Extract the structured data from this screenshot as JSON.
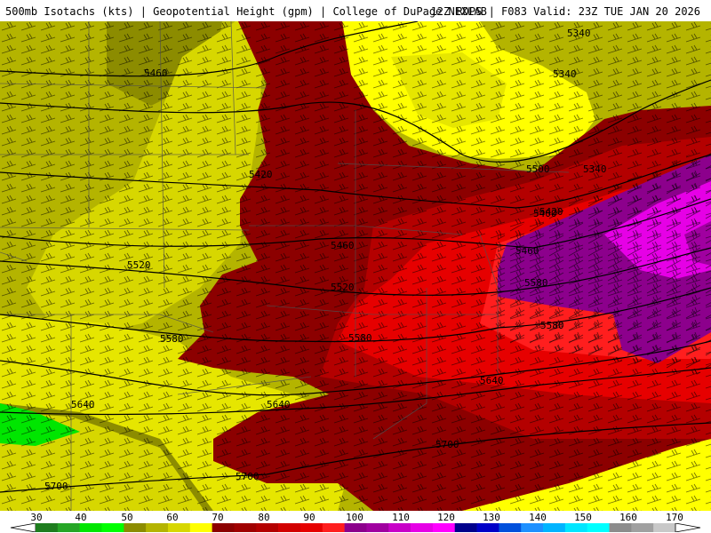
{
  "header": {
    "title_left": "500mb Isotachs (kts) | Geopotential Height (gpm) | College of DuPage NEXLAB",
    "title_right": "12Z RDPS | F083 Valid: 23Z TUE JAN 20 2026"
  },
  "colors": {
    "c30": "#1e8c1e",
    "c40": "#2db42d",
    "c50": "#1ee61e",
    "c60_dark": "#8c8c00",
    "c60": "#b4b400",
    "c70": "#e6e600",
    "c_yellow": "#ffff00",
    "c80": "#8c0000",
    "c90": "#b40000",
    "c100": "#e60000",
    "c110": "#ff1e1e",
    "c120": "#8c008c",
    "c130": "#e600e6",
    "c140": "#00008c",
    "c150": "#0050dc",
    "c160": "#00b4ff",
    "c170": "#a0a0a0",
    "contour": "#000000",
    "borders": "#505050"
  },
  "contours": [
    {
      "label": "5340"
    },
    {
      "label": "5340"
    },
    {
      "label": "5420"
    },
    {
      "label": "5420"
    },
    {
      "label": "5460"
    },
    {
      "label": "5460"
    },
    {
      "label": "5460"
    },
    {
      "label": "5500"
    },
    {
      "label": "5520"
    },
    {
      "label": "5520"
    },
    {
      "label": "5580"
    },
    {
      "label": "5580"
    },
    {
      "label": "5580"
    },
    {
      "label": "5580"
    },
    {
      "label": "5640"
    },
    {
      "label": "5640"
    },
    {
      "label": "5640"
    },
    {
      "label": "5700"
    },
    {
      "label": "5700"
    },
    {
      "label": "5700"
    },
    {
      "label": "5340"
    },
    {
      "label": "5400"
    }
  ],
  "scale": {
    "labels": [
      "30",
      "40",
      "50",
      "60",
      "70",
      "80",
      "90",
      "100",
      "110",
      "120",
      "130",
      "140",
      "150",
      "160",
      "170"
    ],
    "swatches": [
      "#1e7d1e",
      "#26a626",
      "#00e600",
      "#00ff00",
      "#8c8c00",
      "#b4b400",
      "#d7d700",
      "#ffff00",
      "#8c0000",
      "#a00000",
      "#b40000",
      "#d20000",
      "#e60000",
      "#ff1e1e",
      "#8c008c",
      "#a000a0",
      "#c800c8",
      "#e600e6",
      "#ff00ff",
      "#00008c",
      "#0000c8",
      "#0050dc",
      "#1e90ff",
      "#00b4ff",
      "#00e6ff",
      "#00ffff",
      "#8c8c8c",
      "#a0a0a0",
      "#c8c8c8"
    ]
  }
}
